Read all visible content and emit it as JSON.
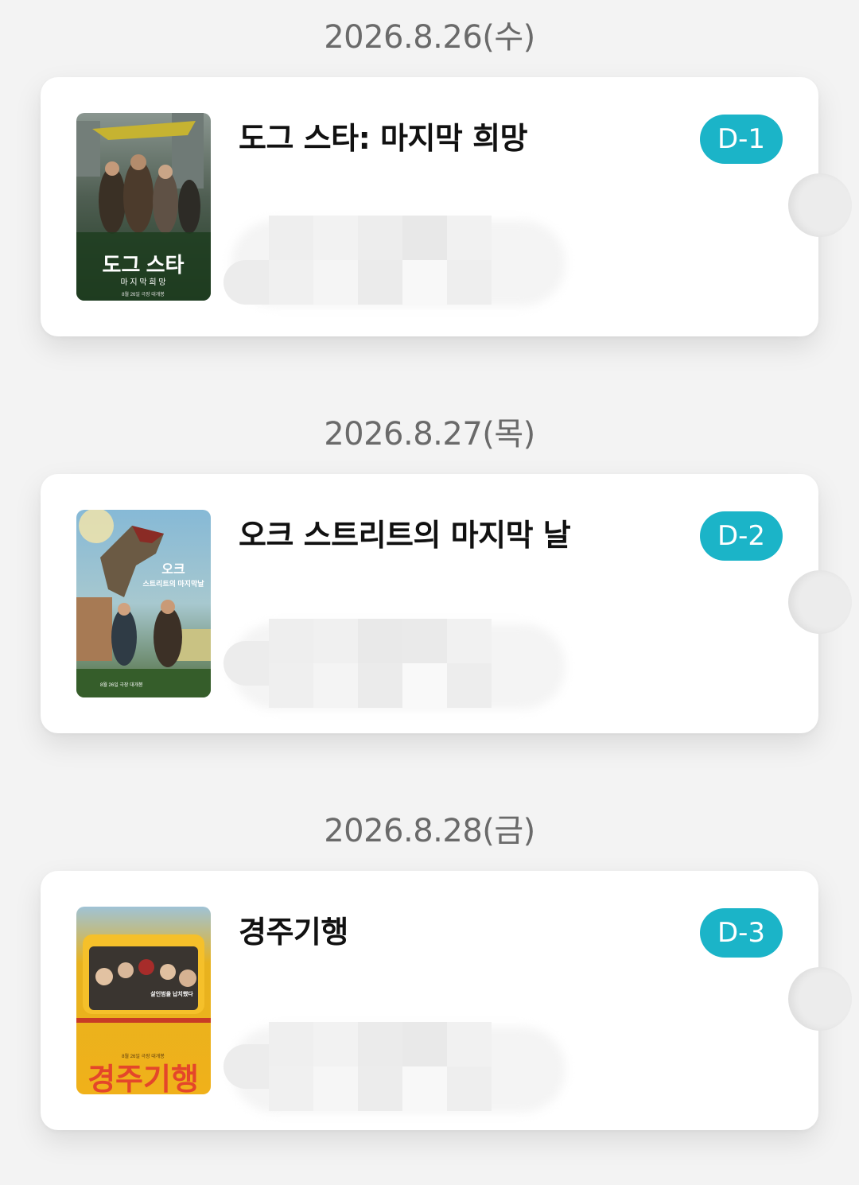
{
  "schedule": [
    {
      "date": "2026.8.26(수)",
      "title": "도그 스타: 마지막 희망",
      "dday": "D-1",
      "poster": {
        "headline": "도그 스타",
        "subline": "마 지 막 희 망",
        "footer": "8월 26일 극장 대개봉"
      }
    },
    {
      "date": "2026.8.27(목)",
      "title": "오크 스트리트의 마지막 날",
      "dday": "D-2",
      "poster": {
        "headline": "오크",
        "subline": "스트리트의 마지막날",
        "footer": "8월 26일 극장 대개봉"
      }
    },
    {
      "date": "2026.8.28(금)",
      "title": "경주기행",
      "dday": "D-3",
      "poster": {
        "headline": "경주기행",
        "subline": "살인범을 납치했다",
        "footer": "8월 26일 극장 대개봉"
      }
    }
  ]
}
